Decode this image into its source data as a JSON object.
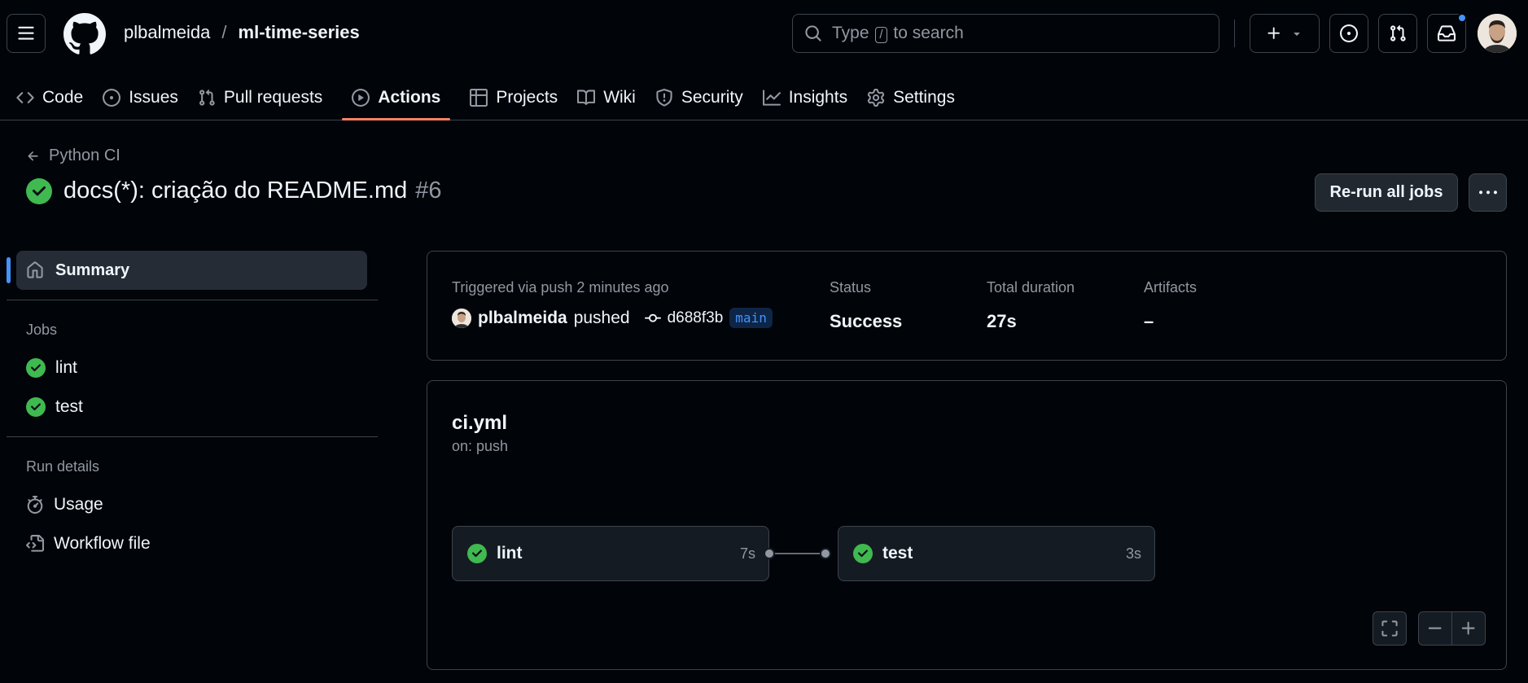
{
  "header": {
    "owner": "plbalmeida",
    "separator": "/",
    "repo": "ml-time-series",
    "search_prefix": "Type",
    "search_key": "/",
    "search_suffix": "to search"
  },
  "tabs": [
    {
      "label": "Code",
      "icon": "code-icon"
    },
    {
      "label": "Issues",
      "icon": "issue-icon"
    },
    {
      "label": "Pull requests",
      "icon": "pull-request-icon"
    },
    {
      "label": "Actions",
      "icon": "play-icon",
      "active": true
    },
    {
      "label": "Projects",
      "icon": "table-icon"
    },
    {
      "label": "Wiki",
      "icon": "book-icon"
    },
    {
      "label": "Security",
      "icon": "shield-icon"
    },
    {
      "label": "Insights",
      "icon": "graph-icon"
    },
    {
      "label": "Settings",
      "icon": "gear-icon"
    }
  ],
  "run": {
    "back_label": "Python CI",
    "title": "docs(*): criação do README.md",
    "number": "#6",
    "rerun_label": "Re-run all jobs"
  },
  "sidebar": {
    "summary_label": "Summary",
    "jobs_heading": "Jobs",
    "jobs": [
      "lint",
      "test"
    ],
    "details_heading": "Run details",
    "usage_label": "Usage",
    "workflow_file_label": "Workflow file"
  },
  "summary": {
    "trigger_text": "Triggered via push 2 minutes ago",
    "actor": "plbalmeida",
    "action": "pushed",
    "sha": "d688f3b",
    "branch": "main",
    "status_label": "Status",
    "status_value": "Success",
    "duration_label": "Total duration",
    "duration_value": "27s",
    "artifacts_label": "Artifacts",
    "artifacts_value": "–"
  },
  "graph": {
    "workflow_name": "ci.yml",
    "trigger": "on: push",
    "jobs": [
      {
        "name": "lint",
        "duration": "7s"
      },
      {
        "name": "test",
        "duration": "3s"
      }
    ]
  },
  "colors": {
    "success": "#3fb950",
    "accent": "#4493f8",
    "tab_underline": "#f78166"
  }
}
